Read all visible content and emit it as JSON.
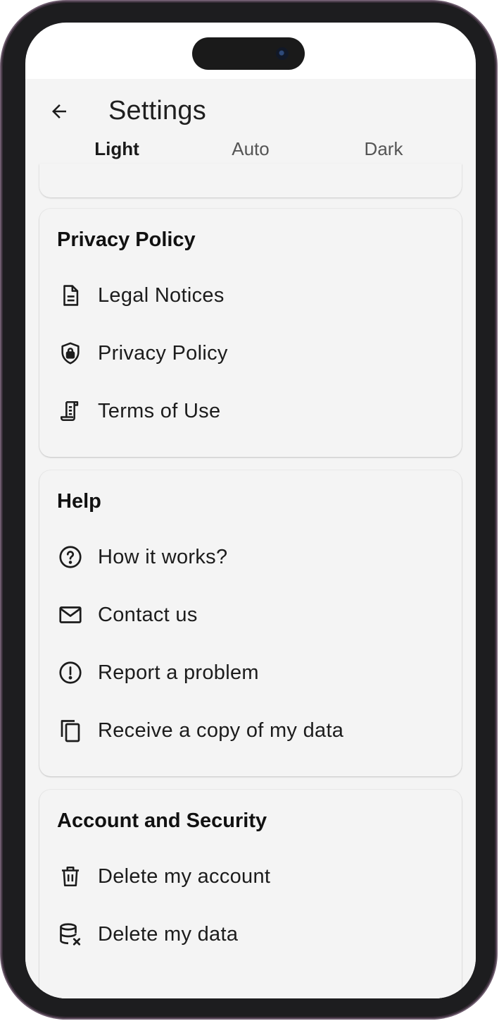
{
  "header": {
    "title": "Settings",
    "back_icon": "arrow-left-icon"
  },
  "theme": {
    "options": [
      "Light",
      "Auto",
      "Dark"
    ],
    "selected": "Light"
  },
  "sections": [
    {
      "title": "Privacy Policy",
      "items": [
        {
          "label": "Legal Notices",
          "icon": "document-icon"
        },
        {
          "label": "Privacy Policy",
          "icon": "shield-lock-icon"
        },
        {
          "label": "Terms of Use",
          "icon": "scroll-icon"
        }
      ]
    },
    {
      "title": "Help",
      "items": [
        {
          "label": "How it works?",
          "icon": "question-circle-icon"
        },
        {
          "label": "Contact us",
          "icon": "mail-icon"
        },
        {
          "label": "Report a problem",
          "icon": "alert-circle-icon"
        },
        {
          "label": "Receive a copy of my data",
          "icon": "copy-icon"
        }
      ]
    },
    {
      "title": "Account and Security",
      "items": [
        {
          "label": "Delete my account",
          "icon": "trash-icon"
        },
        {
          "label": "Delete my data",
          "icon": "database-remove-icon"
        }
      ]
    }
  ]
}
